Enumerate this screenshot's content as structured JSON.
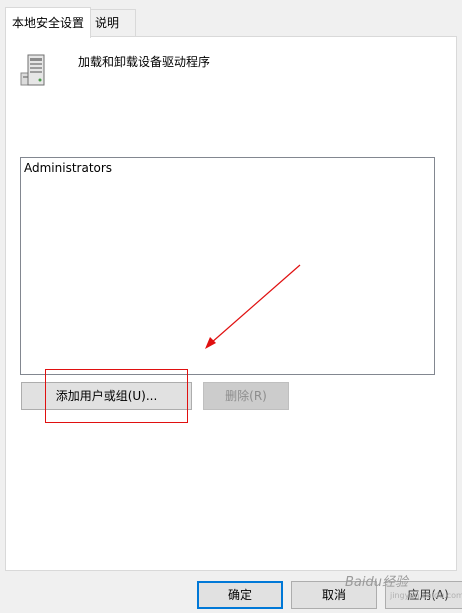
{
  "tabs": [
    {
      "label": "本地安全设置",
      "active": true
    },
    {
      "label": "说明",
      "active": false
    }
  ],
  "policy": {
    "icon": "server-computer-icon",
    "title": "加载和卸载设备驱动程序"
  },
  "assigned_list": {
    "items": [
      "Administrators"
    ]
  },
  "actions": {
    "add_label": "添加用户或组(U)...",
    "remove_label": "删除(R)",
    "remove_enabled": false
  },
  "footer": {
    "ok_label": "确定",
    "cancel_label": "取消",
    "apply_label": "应用(A)"
  },
  "annotations": {
    "color": "#e01010"
  },
  "watermark": {
    "text": "Baidu经验",
    "subtext": "jingyan.baidu.com"
  },
  "colors": {
    "accent": "#0078d7",
    "panel_bg": "#ffffff",
    "window_bg": "#f0f0f0"
  }
}
